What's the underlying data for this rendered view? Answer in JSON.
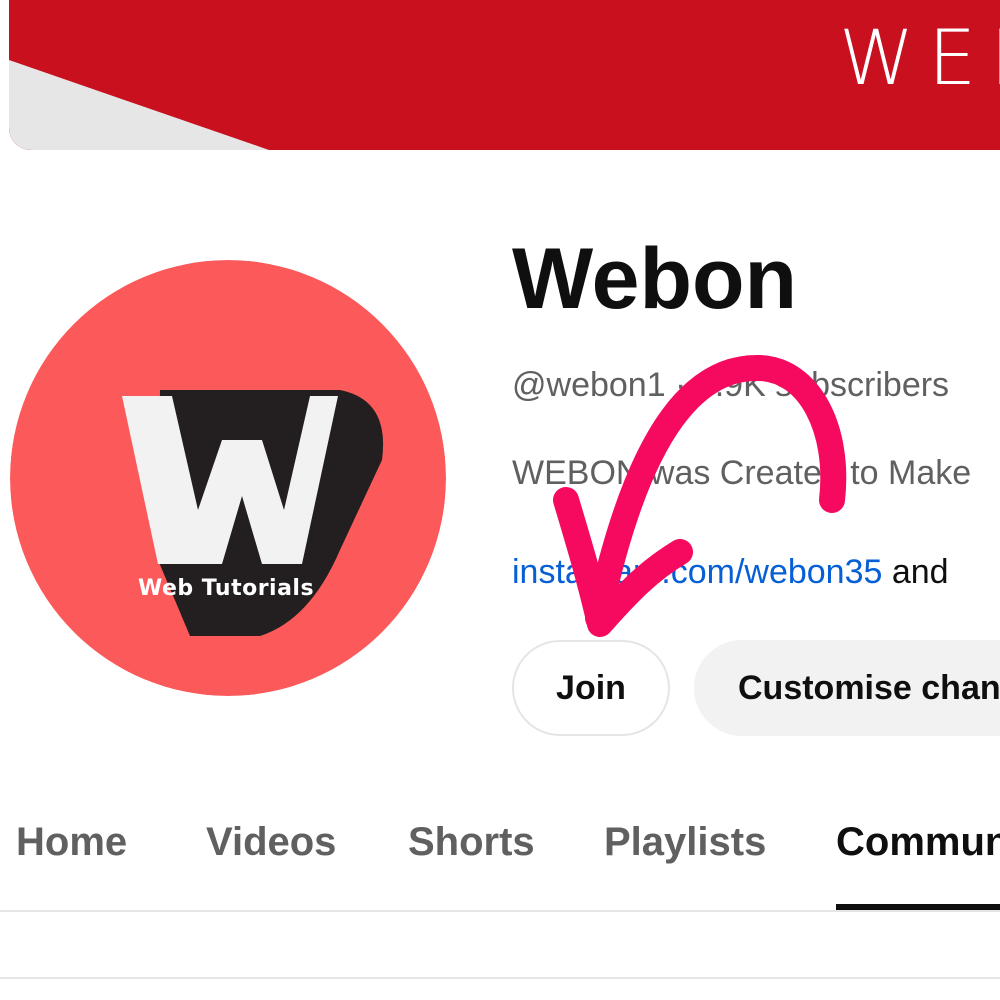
{
  "banner": {
    "text": "WEB",
    "colors": {
      "red": "#c8101e",
      "grey": "#e6e6e6"
    }
  },
  "avatar": {
    "logo_letter": "W",
    "caption": "Web Tutorials",
    "colors": {
      "circle": "#fc5a5a",
      "shadow": "#231f20",
      "letter": "#f2f2f2"
    }
  },
  "channel": {
    "name": "Webon",
    "meta": "@webon1 · 6.9K subscribers",
    "description": "WEBON was Created to Make",
    "link": "instagram.com/webon35",
    "link_suffix": " and"
  },
  "buttons": {
    "join": "Join",
    "customise": "Customise channel"
  },
  "tabs": [
    {
      "label": "Home",
      "active": false
    },
    {
      "label": "Videos",
      "active": false
    },
    {
      "label": "Shorts",
      "active": false
    },
    {
      "label": "Playlists",
      "active": false
    },
    {
      "label": "Community",
      "active": true
    }
  ],
  "annotation": {
    "icon": "curved-arrow-icon",
    "color": "#f50a5f"
  }
}
